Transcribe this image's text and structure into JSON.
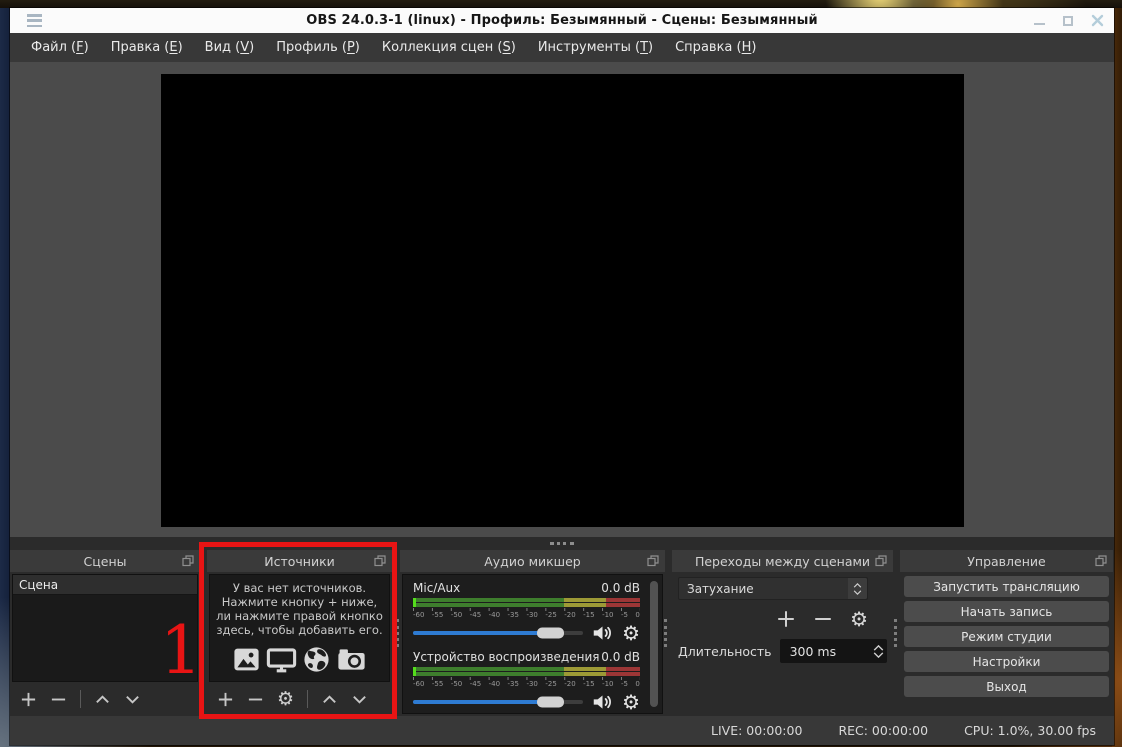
{
  "title_bar": {
    "title": "OBS 24.0.3-1 (linux) - Профиль: Безымянный - Сцены: Безымянный"
  },
  "menu": {
    "items": [
      {
        "pre": "Файл (",
        "key": "F",
        "post": ")"
      },
      {
        "pre": "Правка (",
        "key": "E",
        "post": ")"
      },
      {
        "pre": "Вид (",
        "key": "V",
        "post": ")"
      },
      {
        "pre": "Профиль (",
        "key": "P",
        "post": ")"
      },
      {
        "pre": "Коллекция сцен (",
        "key": "S",
        "post": ")"
      },
      {
        "pre": "Инструменты (",
        "key": "T",
        "post": ")"
      },
      {
        "pre": "Справка (",
        "key": "H",
        "post": ")"
      }
    ]
  },
  "scenes": {
    "title": "Сцены",
    "items": [
      "Сцена"
    ]
  },
  "sources": {
    "title": "Источники",
    "empty_lines": [
      "У вас нет источников.",
      "Нажмите кнопку + ниже,",
      "ли нажмите правой кнопко",
      "здесь, чтобы добавить его."
    ]
  },
  "mixer": {
    "title": "Аудио микшер",
    "ticks": [
      "-60",
      "-55",
      "-50",
      "-45",
      "-40",
      "-35",
      "-30",
      "-25",
      "-20",
      "-15",
      "-10",
      "-5",
      "0"
    ],
    "channels": [
      {
        "name": "Mic/Aux",
        "level": "0.0 dB"
      },
      {
        "name": "Устройство воспроизведения",
        "level": "0.0 dB"
      }
    ]
  },
  "transitions": {
    "title": "Переходы между сценами",
    "selected_transition": "Затухание",
    "duration_label": "Длительность",
    "duration_value": "300 ms"
  },
  "controls": {
    "title": "Управление",
    "buttons": [
      "Запустить трансляцию",
      "Начать запись",
      "Режим студии",
      "Настройки",
      "Выход"
    ]
  },
  "status_bar": {
    "live": "LIVE: 00:00:00",
    "rec": "REC: 00:00:00",
    "cpu": "CPU: 1.0%, 30.00 fps"
  },
  "annotation": {
    "label": "1"
  },
  "colors": {
    "accent_blue": "#2e7bd2",
    "meter_green": "#3e7e2d",
    "meter_yellow": "#9d9a36",
    "meter_red": "#9c3636",
    "meter_peak_green": "#54dd1c",
    "annotation_red": "#e81414",
    "titlebar_bg": "#fbfbfb",
    "menubar_bg": "#383838",
    "canvas_bg": "#4b4b4b",
    "dock_bg": "#2b2b2b"
  }
}
